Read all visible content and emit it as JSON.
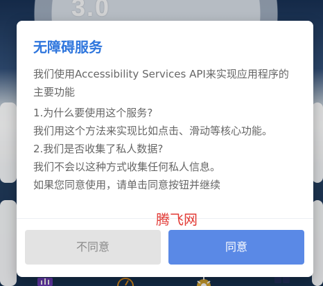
{
  "background": {
    "version_text": "3.0"
  },
  "dialog": {
    "title": "无障碍服务",
    "paragraphs": [
      "我们使用Accessibility Services API来实现应用程序的主要功能",
      "1.为什么要使用这个服务?",
      "我们用这个方法来实现比如点击、滑动等核心功能。",
      "2.我们是否收集了私人数据?",
      "我们不会以这种方式收集任何私人信息。",
      "如果您同意使用，请单击同意按钮并继续"
    ],
    "decline_label": "不同意",
    "agree_label": "同意"
  },
  "watermark": {
    "text": "腾飞网"
  },
  "colors": {
    "title": "#2f76dd",
    "agree_button": "#5a89e6",
    "decline_button": "#e3e3e3",
    "watermark": "#e23a35"
  },
  "bottom_nav_icons": [
    "chart-icon",
    "speedometer-icon",
    "gear-icon",
    "grid-icon"
  ]
}
